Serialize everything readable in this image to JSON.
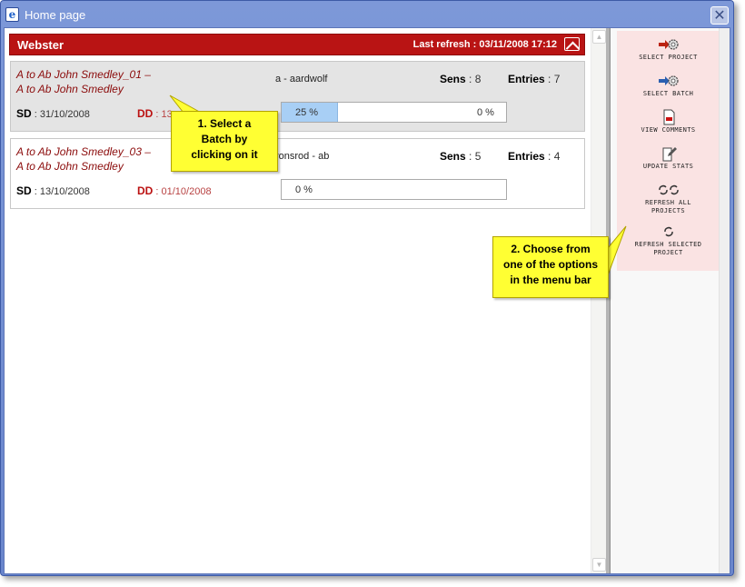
{
  "window": {
    "title": "Home page",
    "close_label": "✕"
  },
  "project": {
    "name": "Webster",
    "last_refresh": "Last refresh : 03/11/2008 17:12"
  },
  "batches": [
    {
      "name_line1": "A to Ab John Smedley_01 –",
      "name_line2": "A to Ab John Smedley",
      "code": "a - aardwolf",
      "sens_label": "Sens",
      "sens_value": " : 8",
      "entries_label": "Entries",
      "entries_value": " : 7",
      "sd_label": "SD",
      "sd_value": " : 31/10/2008",
      "dd_label": "DD",
      "dd_value": " : 13",
      "progress_fraction": 0.25,
      "progress_text": "25 %",
      "progress_text2": "0 %",
      "selected": true
    },
    {
      "name_line1": "A to Ab John Smedley_03 –",
      "name_line2": "A to Ab John Smedley",
      "code": "ronsrod - ab",
      "sens_label": "Sens",
      "sens_value": " : 5",
      "entries_label": "Entries",
      "entries_value": " : 4",
      "sd_label": "SD",
      "sd_value": " : 13/10/2008",
      "dd_label": "DD",
      "dd_value": " : 01/10/2008",
      "progress_fraction": 0,
      "progress_text": "0 %",
      "selected": false
    }
  ],
  "menu": {
    "items": [
      {
        "label": "Select Project",
        "icon": "arrow-gear-icon"
      },
      {
        "label": "Select Batch",
        "icon": "arrow-gear-icon"
      },
      {
        "label": "View Comments",
        "icon": "document-icon"
      },
      {
        "label": "Update Stats",
        "icon": "document-edit-icon"
      },
      {
        "label": "Refresh All",
        "label2": "Projects",
        "icon": "double-refresh-icon"
      },
      {
        "label": "Refresh Selected",
        "label2": "Project",
        "icon": "refresh-icon"
      }
    ]
  },
  "callouts": {
    "one": {
      "line1": "1. Select a",
      "line2": "Batch by",
      "line3": "clicking on it"
    },
    "two": {
      "line1": "2. Choose from",
      "line2": "one of the options",
      "line3": "in the menu bar"
    }
  },
  "colors": {
    "header_red": "#b91414",
    "batch_title": "#8b0b0b",
    "callout_yellow": "#ffff33",
    "menu_bg": "#fae3e3",
    "progress_fill": "#a8cff5"
  }
}
